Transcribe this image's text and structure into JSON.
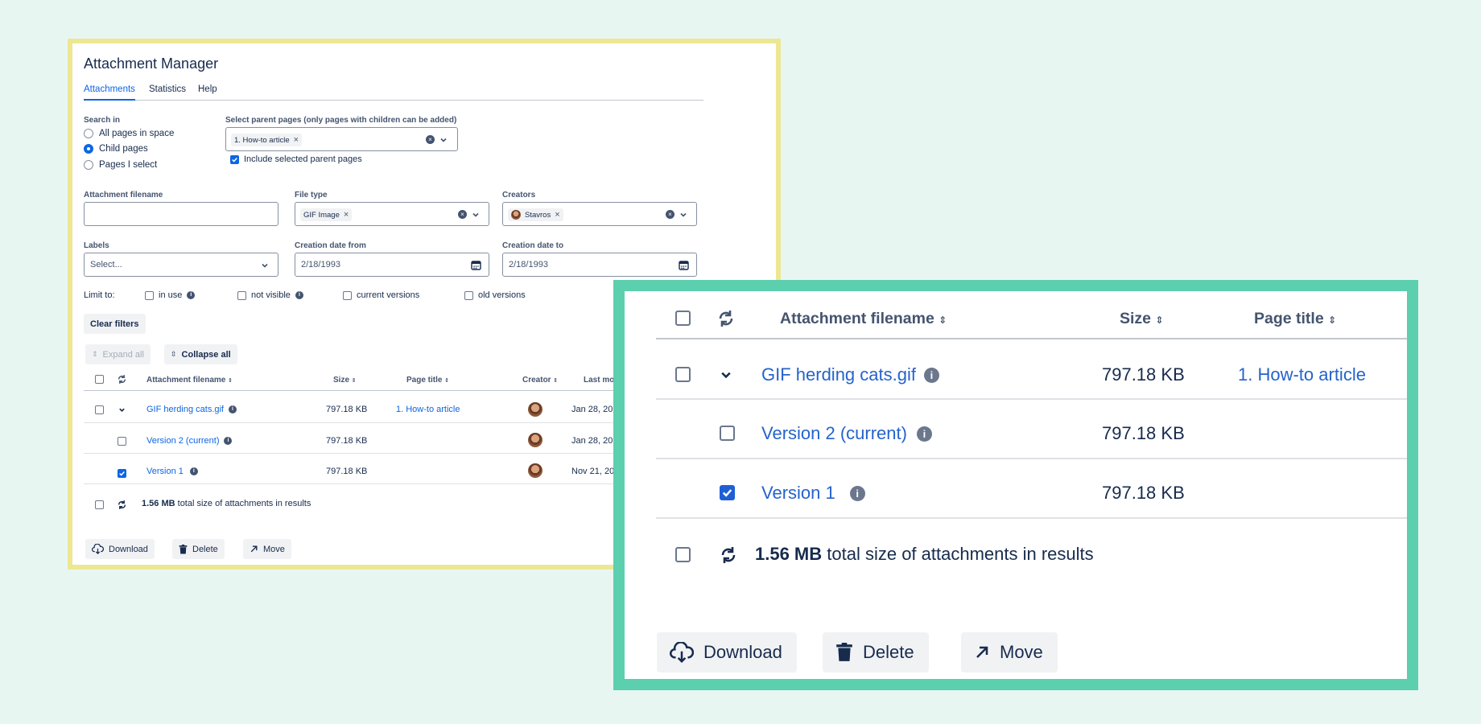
{
  "left": {
    "title": "Attachment Manager",
    "tabs": [
      "Attachments",
      "Statistics",
      "Help"
    ],
    "search_in": {
      "label": "Search in",
      "options": [
        "All pages in space",
        "Child pages",
        "Pages I select"
      ],
      "selected": "Child pages"
    },
    "parent_pages": {
      "label": "Select parent pages (only pages with children can be added)",
      "chip": "1. How-to article",
      "include_label": "Include selected parent pages",
      "include_checked": true
    },
    "filename": {
      "label": "Attachment filename",
      "value": ""
    },
    "file_type": {
      "label": "File type",
      "chip": "GIF Image"
    },
    "creators": {
      "label": "Creators",
      "chip": "Stavros"
    },
    "labels": {
      "label": "Labels",
      "placeholder": "Select..."
    },
    "date_from": {
      "label": "Creation date from",
      "value": "2/18/1993"
    },
    "date_to": {
      "label": "Creation date to",
      "value": "2/18/1993"
    },
    "limit": {
      "label": "Limit to:",
      "options": [
        "in use",
        "not visible",
        "current versions",
        "old versions"
      ]
    },
    "clear_filters": "Clear filters",
    "expand_all": "Expand all",
    "collapse_all": "Collapse all",
    "columns": [
      "Attachment filename",
      "Size",
      "Page title",
      "Creator",
      "Last mod"
    ],
    "rows": [
      {
        "name": "GIF herding cats.gif",
        "size": "797.18 KB",
        "page": "1. How-to article",
        "date": "Jan 28, 20"
      },
      {
        "name": "Version 2 (current)",
        "size": "797.18 KB",
        "page": "",
        "date": "Jan 28, 20"
      },
      {
        "name": "Version 1",
        "size": "797.18 KB",
        "page": "",
        "date": "Nov 21, 20"
      }
    ],
    "total_bold": "1.56 MB",
    "total_text": " total size of attachments in results",
    "actions": [
      "Download",
      "Delete",
      "Move"
    ]
  },
  "right": {
    "columns": [
      "Attachment filename",
      "Size",
      "Page title"
    ],
    "rows": [
      {
        "name": "GIF herding cats.gif",
        "size": "797.18 KB",
        "page": "1. How-to article"
      },
      {
        "name": "Version 2 (current)",
        "size": "797.18 KB",
        "page": ""
      },
      {
        "name": "Version 1",
        "size": "797.18 KB",
        "page": ""
      }
    ],
    "total_bold": "1.56 MB",
    "total_text": " total size of attachments in results",
    "actions": [
      "Download",
      "Delete",
      "Move"
    ]
  },
  "colors": {
    "background": "#e8f6f2",
    "left_frame": "#ede793",
    "right_frame": "#5ccfae",
    "link": "#0c66e4",
    "checkbox_checked": "#1f5fd6"
  }
}
